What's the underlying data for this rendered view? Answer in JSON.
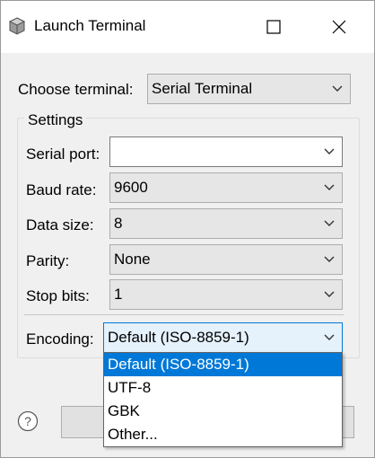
{
  "window": {
    "title": "Launch Terminal",
    "icons": {
      "app": "terminal-cube-icon",
      "maximize": "maximize-icon",
      "close": "close-icon"
    }
  },
  "terminal": {
    "label": "Choose terminal:",
    "selected": "Serial Terminal"
  },
  "settings": {
    "group_label": "Settings",
    "serial_port": {
      "label": "Serial port:",
      "value": ""
    },
    "baud_rate": {
      "label": "Baud rate:",
      "value": "9600"
    },
    "data_size": {
      "label": "Data size:",
      "value": "8"
    },
    "parity": {
      "label": "Parity:",
      "value": "None"
    },
    "stop_bits": {
      "label": "Stop bits:",
      "value": "1"
    }
  },
  "encoding": {
    "label": "Encoding:",
    "selected": "Default (ISO-8859-1)",
    "options": [
      "Default (ISO-8859-1)",
      "UTF-8",
      "GBK",
      "Other..."
    ]
  },
  "footer": {
    "help_icon": "help-icon"
  },
  "colors": {
    "accent": "#0078d7",
    "focused_combo": "#e5f1fb",
    "window_bg": "#f0f0f0"
  }
}
